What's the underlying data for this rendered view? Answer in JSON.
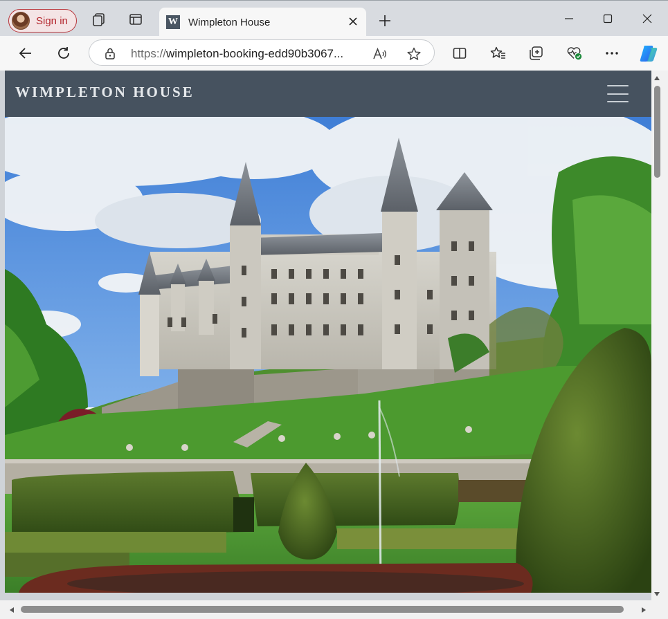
{
  "browser": {
    "profile_button_label": "Sign in",
    "tab": {
      "favicon_letter": "W",
      "title": "Wimpleton House"
    },
    "address": {
      "url_scheme": "https://",
      "url_rest": "wimpleton-booking-edd90b3067..."
    },
    "icons": {
      "workspaces": "workspaces-icon",
      "tab_actions": "vertical-tabs-icon",
      "close_tab": "close-icon",
      "new_tab": "plus-icon",
      "minimize": "minimize-icon",
      "maximize": "maximize-icon",
      "close_window": "close-window-icon",
      "back": "back-arrow-icon",
      "refresh": "refresh-icon",
      "lock": "lock-icon",
      "read_aloud": "read-aloud-icon",
      "favorite": "star-icon",
      "split_screen": "split-screen-icon",
      "favorites": "favorites-icon",
      "collections": "collections-icon",
      "browser_essentials": "heart-pulse-icon",
      "more": "more-icon",
      "copilot": "copilot-icon"
    },
    "colors": {
      "profile_accent": "#b3262d",
      "copilot_accent": "#2f7bea"
    }
  },
  "site": {
    "title": "WIMPLETON HOUSE",
    "menu_icon": "hamburger-menu-icon",
    "header_color": "#46525f",
    "hero_alt": "castle"
  }
}
